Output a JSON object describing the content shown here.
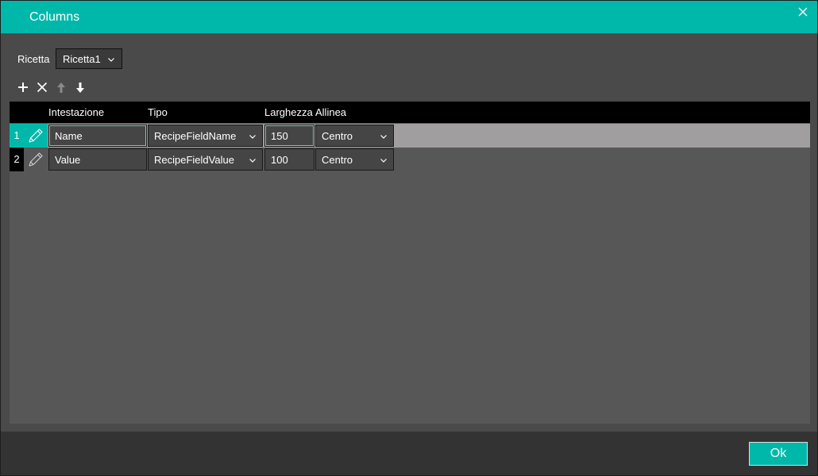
{
  "window": {
    "title": "Columns",
    "accent": "#00b8aa"
  },
  "recipe": {
    "label": "Ricetta",
    "selected": "Ricetta1"
  },
  "toolbar": {
    "icons": [
      "plus-icon",
      "delete-icon",
      "arrow-up-icon",
      "arrow-down-icon"
    ]
  },
  "table": {
    "columns": [
      "Intestazione",
      "Tipo",
      "Larghezza",
      "Allinea"
    ],
    "rows": [
      {
        "num": "1",
        "heading": "Name",
        "type": "RecipeFieldName",
        "width": "150",
        "align": "Centro",
        "selected": true
      },
      {
        "num": "2",
        "heading": "Value",
        "type": "RecipeFieldValue",
        "width": "100",
        "align": "Centro",
        "selected": false
      }
    ]
  },
  "footer": {
    "ok_label": "Ok"
  }
}
